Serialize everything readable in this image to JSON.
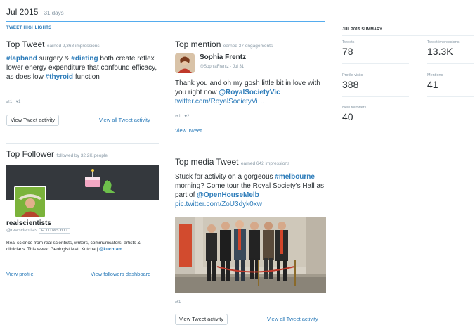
{
  "header": {
    "month": "Jul 2015",
    "days": "· 31 days"
  },
  "highlights_label": "TWEET HIGHLIGHTS",
  "top_tweet": {
    "title": "Top Tweet",
    "sub": "earned 2,368 impressions",
    "segments": [
      {
        "text": "#lapband",
        "tag": true
      },
      {
        "text": " surgery & ",
        "tag": false
      },
      {
        "text": "#dieting",
        "tag": true
      },
      {
        "text": " both create reflex lower energy expenditure that confound efficacy, as does low ",
        "tag": false
      },
      {
        "text": "#thyroid",
        "tag": true
      },
      {
        "text": " function",
        "tag": false
      }
    ],
    "retweets": "1",
    "likes": "1",
    "activity_button": "View Tweet activity",
    "all_link": "View all Tweet activity"
  },
  "top_mention": {
    "title": "Top mention",
    "sub": "earned 37 engagements",
    "name": "Sophia Frentz",
    "handle": "@SophiaFrentz",
    "date": "· Jul 31",
    "text": "Thank you and oh my gosh little bit in love with you right now ",
    "mention": "@RoyalSocietyVic",
    "url": "twitter.com/RoyalSocietyVi…",
    "retweets": "1",
    "likes": "2",
    "view_link": "View Tweet"
  },
  "top_follower": {
    "title": "Top Follower",
    "sub": "followed by 32.2K people",
    "name": "realscientists",
    "handle": "@realscientists",
    "follows_you": "FOLLOWS YOU",
    "bio": "Real science from real scientists, writers, communicators, artists & clinicians. This week: Geologist Matt Kutcha | ",
    "bio_mention": "@kuchtam",
    "view_profile": "View profile",
    "dashboard_link": "View followers dashboard"
  },
  "top_media": {
    "title": "Top media Tweet",
    "sub": "earned 642 impressions",
    "text": "Stuck for activity on a gorgeous ",
    "tag": "#melbourne",
    "text2": " morning? Come tour the Royal Society's Hall as part of ",
    "mention": "@OpenHouseMelb",
    "url": "pic.twitter.com/ZoU3dyk0xw",
    "retweets": "1",
    "activity_button": "View Tweet activity",
    "all_link": "View all Tweet activity"
  },
  "summary": {
    "title": "JUL 2015 SUMMARY",
    "tweets_label": "Tweets",
    "tweets_value": "78",
    "impressions_label": "Tweet impressions",
    "impressions_value": "13.3K",
    "visits_label": "Profile visits",
    "visits_value": "388",
    "mentions_label": "Mentions",
    "mentions_value": "41",
    "followers_label": "New followers",
    "followers_value": "40"
  },
  "colors": {
    "accent": "#55acee",
    "link": "#2b7bb9",
    "text": "#292f33",
    "muted": "#8899a6"
  }
}
